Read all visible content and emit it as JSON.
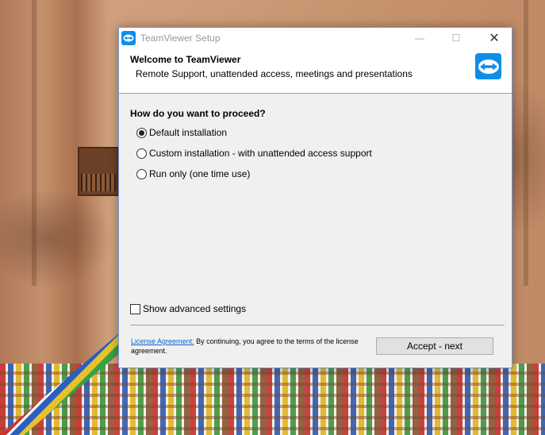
{
  "window": {
    "title": "TeamViewer Setup",
    "minimize_glyph": "—",
    "maximize_glyph": "☐",
    "close_glyph": "✕"
  },
  "header": {
    "title": "Welcome to TeamViewer",
    "subtitle": "Remote Support, unattended access, meetings and presentations",
    "logo_icon": "teamviewer-logo-icon"
  },
  "main": {
    "question": "How do you want to proceed?",
    "options": [
      {
        "label": "Default installation",
        "checked": true
      },
      {
        "label": "Custom installation - with unattended access support",
        "checked": false
      },
      {
        "label": "Run only (one time use)",
        "checked": false
      }
    ],
    "advanced": {
      "label": "Show advanced settings",
      "checked": false
    }
  },
  "footer": {
    "license_link": "License Agreement:",
    "license_text": " By continuing, you agree to the terms of the license agreement.",
    "next_button": "Accept - next"
  },
  "colors": {
    "accent": "#0e8ee9",
    "link": "#0066cc"
  }
}
